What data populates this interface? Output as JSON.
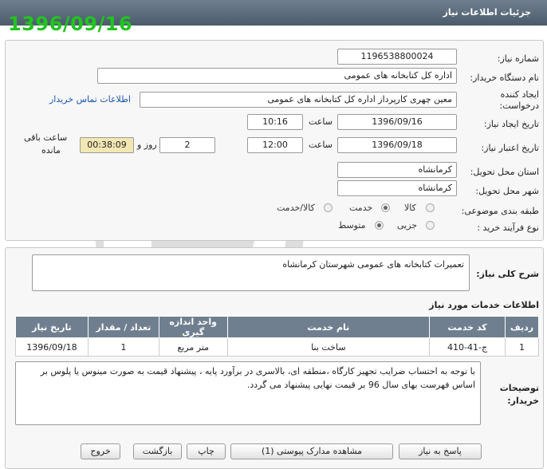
{
  "header": {
    "title": "جزئیات اطلاعات نیاز"
  },
  "stamp_date": "1396/09/16",
  "need_number": {
    "label": "شماره نیاز:",
    "value": "1196538800024"
  },
  "buyer_org": {
    "label": "نام دستگاه خریدار:",
    "value": "اداره کل کتابخانه های عمومی"
  },
  "requester": {
    "label_line1": "ایجاد کننده",
    "label_line2": "درخواست:",
    "value": "معین چهری کارپرداز اداره کل کتابخانه های عمومی",
    "contact_link": "اطلاعات تماس خریدار"
  },
  "created": {
    "label": "تاریخ ایجاد نیاز:",
    "date": "1396/09/16",
    "time_label": "ساعت",
    "time": "10:16"
  },
  "deadline": {
    "label": "تاریخ اعتبار نیاز:",
    "date": "1396/09/18",
    "time_label": "ساعت",
    "time": "12:00",
    "days": "2",
    "days_label": "روز و",
    "remaining": "00:38:09",
    "remaining_label_line1": "ساعت باقی",
    "remaining_label_line2": "مانده"
  },
  "province": {
    "label": "استان محل تحویل:",
    "value": "کرمانشاه"
  },
  "city": {
    "label": "شهر محل تحویل:",
    "value": "کرمانشاه"
  },
  "category": {
    "label": "طبقه بندی موضوعی:",
    "options": [
      "کالا",
      "خدمت",
      "کالا/خدمت"
    ],
    "selected": "خدمت"
  },
  "process": {
    "label": "نوع فرآیند خرید :",
    "options": [
      "جزیی",
      "متوسط"
    ],
    "selected": "متوسط"
  },
  "description": {
    "label": "شرح کلی نیاز:",
    "value": "تعمیرات کتابخانه های عمومی شهرستان کرمانشاه"
  },
  "services": {
    "title": "اطلاعات خدمات مورد نیاز",
    "columns": [
      "ردیف",
      "کد خدمت",
      "نام خدمت",
      "واحد اندازه گیری",
      "تعداد / مقدار",
      "تاریخ نیاز"
    ],
    "rows": [
      [
        "1",
        "ج-41-410",
        "ساخت بنا",
        "متر مربع",
        "1",
        "1396/09/18"
      ]
    ]
  },
  "buyer_notes": {
    "label_line1": "توضیحات",
    "label_line2": "خریدار:",
    "value": "با توجه به احتساب ضرایب تجهیز کارگاه ،منطقه ای، بالاسری در برآورد پایه ، پیشنهاد قیمت به صورت مینوس یا پلوس بر اساس فهرست بهای سال 96 بر قیمت نهایی پیشنهاد می گردد."
  },
  "buttons": {
    "reply": "پاسخ به نیاز",
    "attachments": "مشاهده مدارک پیوستی (1)",
    "print": "چاپ",
    "back": "بازگشت",
    "exit": "خروج"
  },
  "colors": {
    "header": "#5c6c7c",
    "stamp": "#21c41f",
    "link": "#1a56b0",
    "remaining_bg": "#f2e6b3"
  }
}
